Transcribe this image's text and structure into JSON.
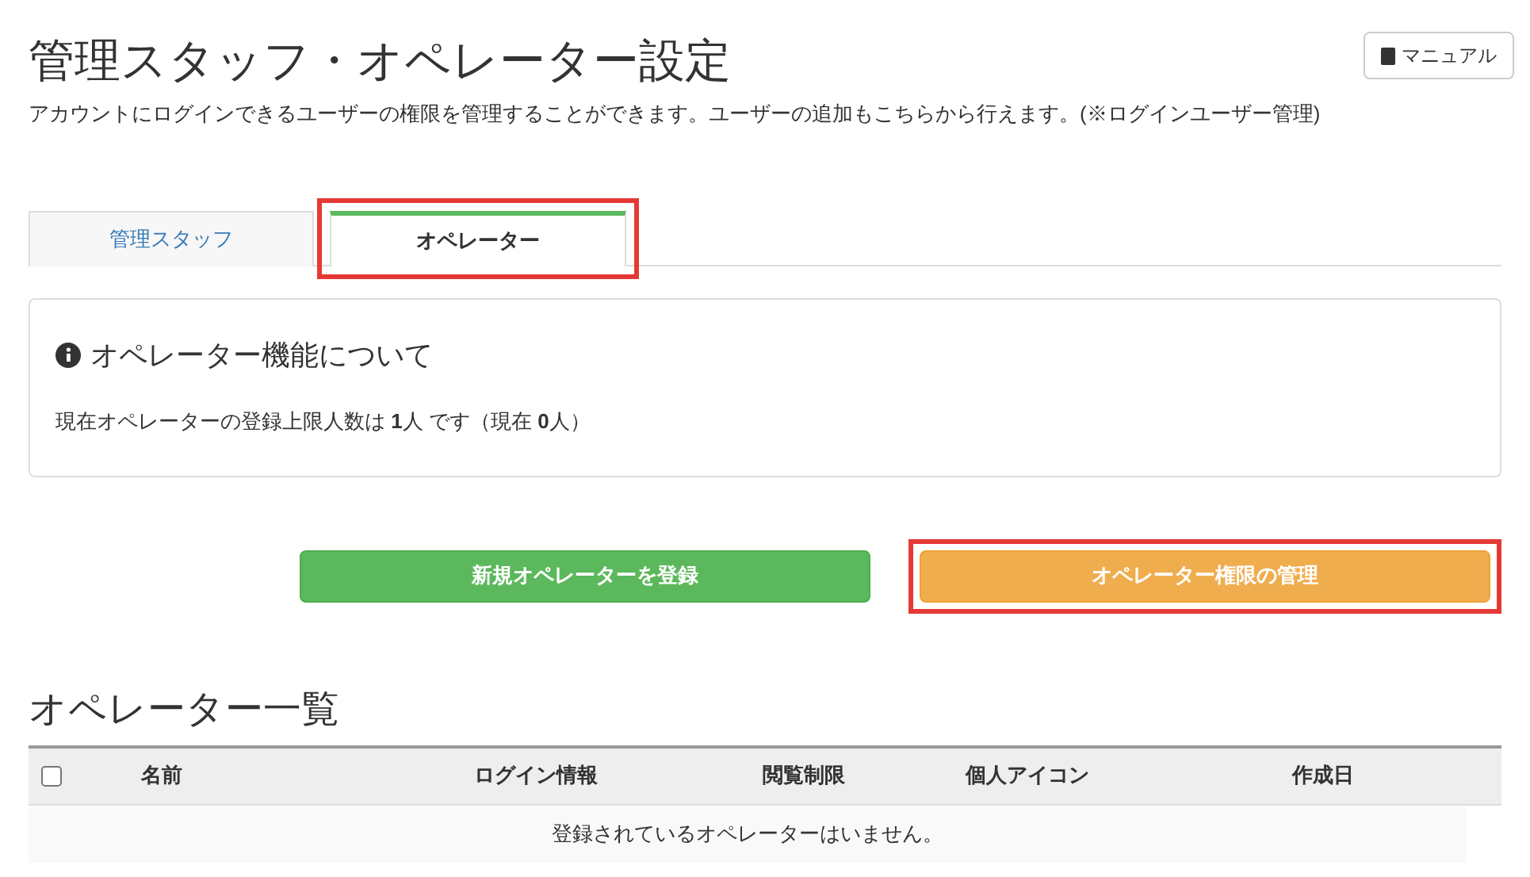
{
  "header": {
    "title": "管理スタッフ・オペレーター設定",
    "manual_button": "マニュアル",
    "description": "アカウントにログインできるユーザーの権限を管理することができます。ユーザーの追加もこちらから行えます。(※ログインユーザー管理)"
  },
  "tabs": [
    {
      "label": "管理スタッフ",
      "selected": false,
      "highlighted": false
    },
    {
      "label": "オペレーター",
      "selected": true,
      "highlighted": true
    }
  ],
  "info": {
    "title": "オペレーター機能について",
    "text": "現在オペレーターの登録上限人数は **1**人 です（現在 **0**人）"
  },
  "actions": [
    {
      "label": "新規オペレーターを登録",
      "kind": "success",
      "highlighted": false
    },
    {
      "label": "オペレーター権限の管理",
      "kind": "warning",
      "highlighted": true
    }
  ],
  "list": {
    "heading": "オペレーター一覧",
    "select_all_checked": false,
    "columns": [
      "名前",
      "ログイン情報",
      "閲覧制限",
      "個人アイコン",
      "作成日"
    ],
    "empty_message": "登録されているオペレーターはいません。"
  }
}
